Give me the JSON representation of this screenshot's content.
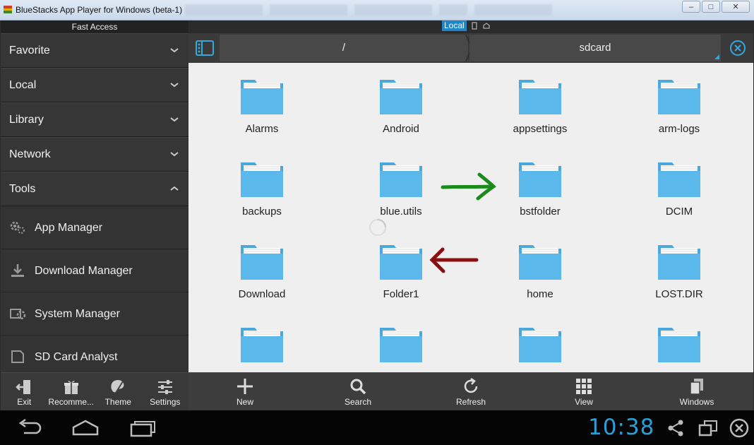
{
  "window": {
    "title": "BlueStacks App Player for Windows (beta-1)",
    "minimize": "–",
    "maximize": "□",
    "close": "✕"
  },
  "tabs": {
    "local_label": "Local"
  },
  "sidebar": {
    "header": "Fast Access",
    "categories": [
      {
        "label": "Favorite",
        "expanded": false
      },
      {
        "label": "Local",
        "expanded": false
      },
      {
        "label": "Library",
        "expanded": false
      },
      {
        "label": "Network",
        "expanded": false
      },
      {
        "label": "Tools",
        "expanded": true
      }
    ],
    "tools": [
      {
        "label": "App Manager",
        "icon": "gears-icon"
      },
      {
        "label": "Download Manager",
        "icon": "download-icon"
      },
      {
        "label": "System Manager",
        "icon": "gear-icon"
      },
      {
        "label": "SD Card Analyst",
        "icon": "sdcard-icon"
      }
    ],
    "bottom": [
      {
        "label": "Exit",
        "icon": "exit-icon"
      },
      {
        "label": "Recomme...",
        "icon": "gift-icon"
      },
      {
        "label": "Theme",
        "icon": "palette-icon"
      },
      {
        "label": "Settings",
        "icon": "sliders-icon"
      }
    ]
  },
  "path": {
    "root": "/",
    "current": "sdcard"
  },
  "folders": [
    "Alarms",
    "Android",
    "appsettings",
    "arm-logs",
    "backups",
    "blue.utils",
    "bstfolder",
    "DCIM",
    "Download",
    "Folder1",
    "home",
    "LOST.DIR",
    "",
    "",
    "",
    ""
  ],
  "toolbar": [
    {
      "label": "New",
      "icon": "plus-icon"
    },
    {
      "label": "Search",
      "icon": "search-icon"
    },
    {
      "label": "Refresh",
      "icon": "refresh-icon"
    },
    {
      "label": "View",
      "icon": "grid-icon"
    },
    {
      "label": "Windows",
      "icon": "windows-icon"
    }
  ],
  "status": {
    "clock": "10:38"
  },
  "colors": {
    "accent": "#2a9fd6",
    "folder": "#5bb8ea",
    "green_arrow": "#1a8a1a",
    "red_arrow": "#8b0f0f"
  }
}
